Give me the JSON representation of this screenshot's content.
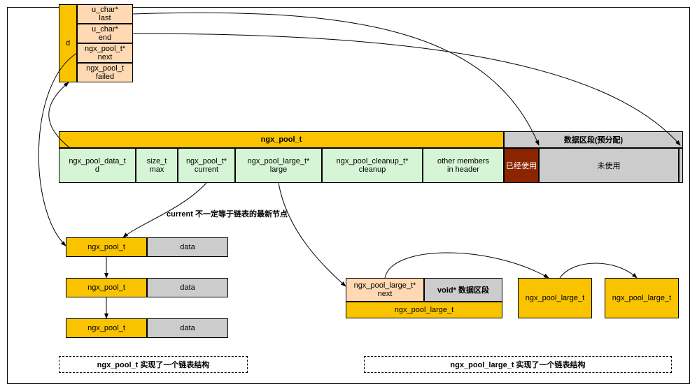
{
  "d_block": {
    "label": "d",
    "fields": [
      "u_char*\nlast",
      "u_char*\nend",
      "ngx_pool_t*\nnext",
      "ngx_pool_t\nfailed"
    ]
  },
  "main_struct": {
    "header": "ngx_pool_t",
    "region_header": "数据区段(预分配)",
    "fields": [
      "ngx_pool_data_t\nd",
      "size_t\nmax",
      "ngx_pool_t*\ncurrent",
      "ngx_pool_large_t*\nlarge",
      "ngx_pool_cleanup_t*\ncleanup",
      "other members\nin header"
    ],
    "used": "已经使用",
    "unused": "未使用"
  },
  "note": "current 不一定等于链表的最新节点",
  "pool_list": {
    "label": "ngx_pool_t",
    "data": "data"
  },
  "large_struct": {
    "next": "ngx_pool_large_t*\nnext",
    "data": "void* 数据区段",
    "name": "ngx_pool_large_t"
  },
  "large_node": "ngx_pool_large_t",
  "caption_pool": "ngx_pool_t 实现了一个链表结构",
  "caption_large": "ngx_pool_large_t 实现了一个链表结构"
}
